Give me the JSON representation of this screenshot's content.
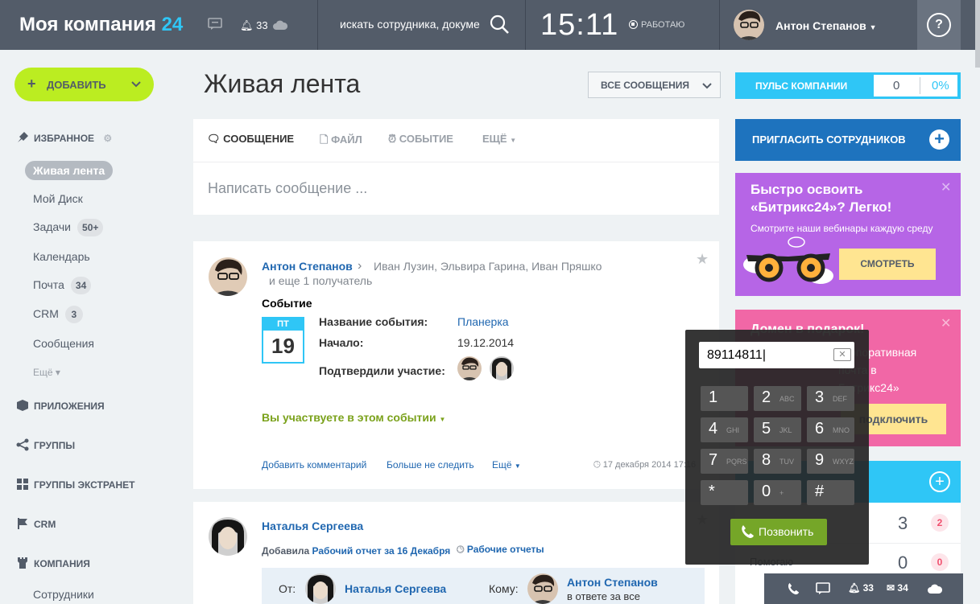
{
  "topbar": {
    "logo_text": "Моя компания",
    "logo_num": "24",
    "notifications_count": "33",
    "search_placeholder": "искать сотрудника, докуме",
    "clock": "15:11",
    "work_status": "РАБОТАЮ",
    "user_name": "Антон Степанов",
    "help_label": "?"
  },
  "sidebar": {
    "add_button": "ДОБАВИТЬ",
    "favorites": "ИЗБРАННОЕ",
    "items": [
      {
        "label": "Живая лента"
      },
      {
        "label": "Мой Диск"
      },
      {
        "label": "Задачи",
        "badge": "50+"
      },
      {
        "label": "Календарь"
      },
      {
        "label": "Почта",
        "badge": "34"
      },
      {
        "label": "CRM",
        "badge": "3"
      },
      {
        "label": "Сообщения"
      }
    ],
    "more": "Ещё",
    "sections": [
      "ПРИЛОЖЕНИЯ",
      "ГРУППЫ",
      "ГРУППЫ ЭКСТРАНЕТ",
      "CRM",
      "КОМПАНИЯ"
    ],
    "employees": "Сотрудники"
  },
  "main": {
    "title": "Живая лента",
    "filter": "ВСЕ СООБЩЕНИЯ",
    "composer": {
      "tabs": [
        "СООБЩЕНИЕ",
        "ФАЙЛ",
        "СОБЫТИЕ",
        "ЕЩЁ"
      ],
      "placeholder": "Написать сообщение ..."
    },
    "post1": {
      "author": "Антон Степанов",
      "recipients": "Иван Лузин, Эльвира Гарина, Иван Пряшко",
      "more_recipients": "и еще 1 получатель",
      "event_label": "Событие",
      "cal_month": "ПТ",
      "cal_day": "19",
      "name_key": "Название события:",
      "name_val": "Планерка",
      "start_key": "Начало:",
      "start_val": "19.12.2014",
      "confirmed_key": "Подтвердили участие:",
      "participating": "Вы участвуете в этом событии",
      "add_comment": "Добавить комментарий",
      "unfollow": "Больше не следить",
      "more": "Ещё",
      "date": "17 декабря 2014 17:16"
    },
    "post2": {
      "author": "Наталья Сергеева",
      "added": "Добавила",
      "report_link": "Рабочий отчет за 16 Декабря",
      "reports": "Рабочие отчеты",
      "from_label": "От:",
      "from_name": "Наталья Сергеева",
      "to_label": "Кому:",
      "to_name": "Антон Степанов",
      "reply": "в ответе за все"
    }
  },
  "right": {
    "pulse_label": "ПУЛЬС КОМПАНИИ",
    "pulse_value": "0",
    "pulse_percent": "0%",
    "invite": "ПРИГЛАСИТЬ СОТРУДНИКОВ",
    "promo_title": "Быстро освоить «Битрикс24»? Легко!",
    "promo_sub": "Смотрите наши вебинары каждую среду",
    "promo_btn": "СМОТРЕТЬ",
    "domain_title": "Домен в подарок!",
    "domain_text1": "корпоративная",
    "domain_text2": "почта в",
    "domain_text3": "Битрикс24»",
    "domain_btn": "подключить",
    "tasks_count1": "3",
    "tasks_badge1": "2",
    "tasks_label2": "Помогаю",
    "tasks_count2": "0",
    "tasks_badge2": "0"
  },
  "dialer": {
    "number": "89114811",
    "keys": [
      {
        "n": "1",
        "l": ""
      },
      {
        "n": "2",
        "l": "ABC"
      },
      {
        "n": "3",
        "l": "DEF"
      },
      {
        "n": "4",
        "l": "GHI"
      },
      {
        "n": "5",
        "l": "JKL"
      },
      {
        "n": "6",
        "l": "MNO"
      },
      {
        "n": "7",
        "l": "PQRS"
      },
      {
        "n": "8",
        "l": "TUV"
      },
      {
        "n": "9",
        "l": "WXYZ"
      },
      {
        "n": "*",
        "l": ""
      },
      {
        "n": "0",
        "l": "+"
      },
      {
        "n": "#",
        "l": ""
      }
    ],
    "call_btn": "Позвонить"
  },
  "bottombar": {
    "notifications": "33",
    "mail": "34"
  },
  "colors": {
    "topbar": "#535c69",
    "accent_blue": "#2fc6f6",
    "add_green": "#bbed21",
    "link": "#2067b0",
    "promo_purple": "#b665e6",
    "promo_pink": "#f167a6",
    "call_green": "#75a628"
  }
}
